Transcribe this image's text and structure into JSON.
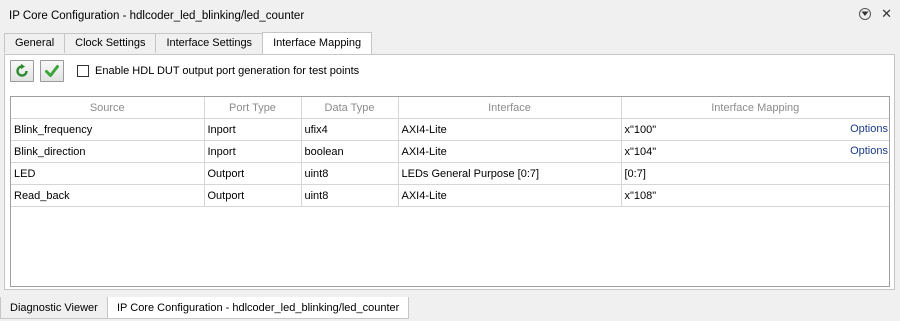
{
  "window": {
    "title": "IP Core Configuration - hdlcoder_led_blinking/led_counter"
  },
  "tabs": [
    {
      "label": "General"
    },
    {
      "label": "Clock Settings"
    },
    {
      "label": "Interface Settings"
    },
    {
      "label": "Interface Mapping",
      "active": true
    }
  ],
  "toolbar": {
    "checkbox_label": "Enable HDL DUT output port generation for test points",
    "checkbox_checked": false
  },
  "table": {
    "headers": [
      "Source",
      "Port Type",
      "Data Type",
      "Interface",
      "Interface Mapping"
    ],
    "rows": [
      {
        "source": "Blink_frequency",
        "port_type": "Inport",
        "data_type": "ufix4",
        "interface": "AXI4-Lite",
        "mapping": "x\"100\"",
        "options": "Options"
      },
      {
        "source": "Blink_direction",
        "port_type": "Inport",
        "data_type": "boolean",
        "interface": "AXI4-Lite",
        "mapping": "x\"104\"",
        "options": "Options"
      },
      {
        "source": "LED",
        "port_type": "Outport",
        "data_type": "uint8",
        "interface": "LEDs General Purpose [0:7]",
        "mapping": "[0:7]",
        "options": ""
      },
      {
        "source": "Read_back",
        "port_type": "Outport",
        "data_type": "uint8",
        "interface": "AXI4-Lite",
        "mapping": "x\"108\"",
        "options": ""
      }
    ]
  },
  "bottom_tabs": [
    {
      "label": "Diagnostic Viewer"
    },
    {
      "label": "IP Core Configuration - hdlcoder_led_blinking/led_counter",
      "active": true
    }
  ],
  "colors": {
    "options_link": "#1b3a8a",
    "refresh_icon": "#2e8b2e",
    "check_icon": "#3aa53a"
  }
}
